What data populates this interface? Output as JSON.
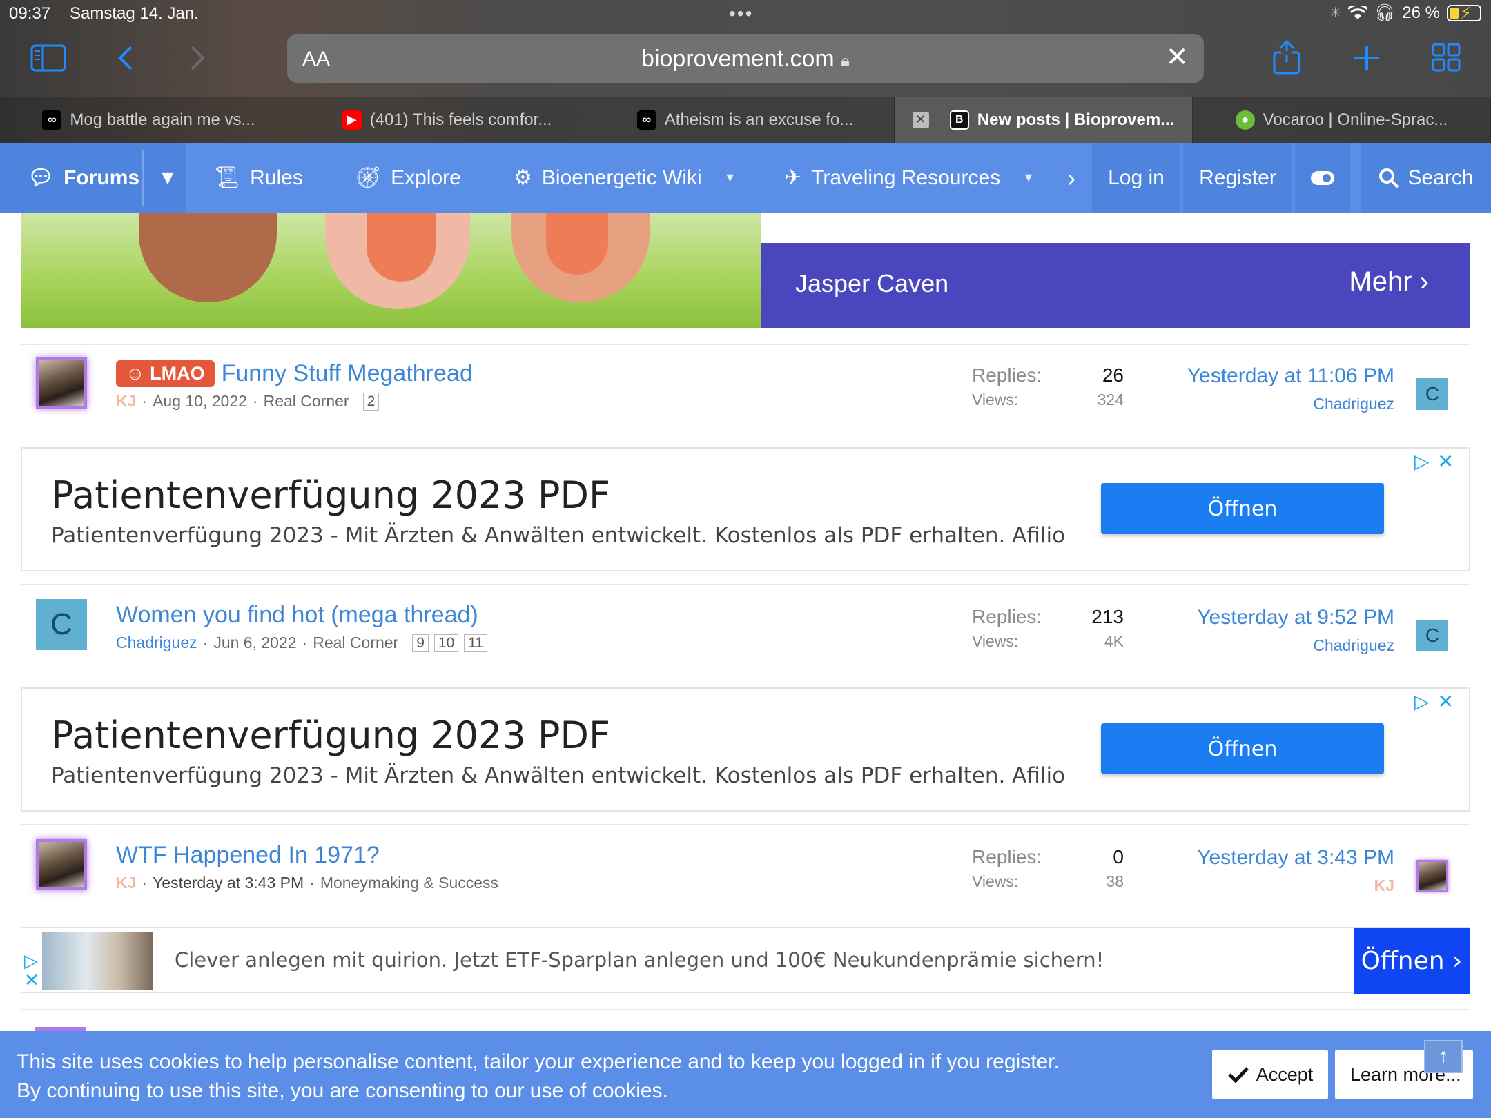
{
  "status": {
    "time": "09:37",
    "date": "Samstag 14. Jan.",
    "battery": "26 %"
  },
  "browser": {
    "address_aa": "AA",
    "url": "bioprovement.com",
    "tabs": [
      {
        "title": "Mog battle again me vs...",
        "favicon": "infinity-icon"
      },
      {
        "title": "(401) This feels comfor...",
        "favicon": "youtube-icon"
      },
      {
        "title": "Atheism is an excuse fo...",
        "favicon": "infinity-icon"
      },
      {
        "title": "New posts | Bioprovem...",
        "favicon": "b-icon",
        "active": true
      },
      {
        "title": "Vocaroo | Online-Sprac...",
        "favicon": "vocaroo-icon"
      }
    ]
  },
  "nav": {
    "forums": "Forums",
    "rules": "Rules",
    "explore": "Explore",
    "wiki": "Bioenergetic Wiki",
    "traveling": "Traveling Resources",
    "login": "Log in",
    "register": "Register",
    "search": "Search"
  },
  "top_ad": {
    "name": "Jasper Caven",
    "more": "Mehr"
  },
  "threads": [
    {
      "label": "LMAO",
      "title": "Funny Stuff Megathread",
      "author": "KJ",
      "date": "Aug 10, 2022",
      "forum": "Real Corner",
      "pages": [
        "2"
      ],
      "replies_label": "Replies:",
      "replies": "26",
      "views_label": "Views:",
      "views": "324",
      "last_time": "Yesterday at 11:06 PM",
      "last_user": "Chadriguez",
      "last_user_initial": "C"
    },
    {
      "title": "Women you find hot (mega thread)",
      "author": "Chadriguez",
      "author_initial": "C",
      "date": "Jun 6, 2022",
      "forum": "Real Corner",
      "pages": [
        "9",
        "10",
        "11"
      ],
      "replies_label": "Replies:",
      "replies": "213",
      "views_label": "Views:",
      "views": "4K",
      "last_time": "Yesterday at 9:52 PM",
      "last_user": "Chadriguez",
      "last_user_initial": "C"
    },
    {
      "title": "WTF Happened In 1971?",
      "author": "KJ",
      "date": "Yesterday at 3:43 PM",
      "forum": "Moneymaking & Success",
      "replies_label": "Replies:",
      "replies": "0",
      "views_label": "Views:",
      "views": "38",
      "last_time": "Yesterday at 3:43 PM",
      "last_user": "KJ"
    }
  ],
  "ads": [
    {
      "headline": "Patientenverfügung 2023 PDF",
      "body": "Patientenverfügung 2023 - Mit Ärzten & Anwälten entwickelt. Kostenlos als PDF erhalten. Afilio",
      "cta": "Öffnen"
    },
    {
      "headline": "Patientenverfügung 2023 PDF",
      "body": "Patientenverfügung 2023 - Mit Ärzten & Anwälten entwickelt. Kostenlos als PDF erhalten. Afilio",
      "cta": "Öffnen"
    }
  ],
  "banner_ad": {
    "text": "Clever anlegen mit quirion. Jetzt ETF-Sparplan anlegen und 100€ Neukundenprämie sichern!",
    "cta": "Öffnen"
  },
  "cookie": {
    "line1": "This site uses cookies to help personalise content, tailor your experience and to keep you logged in if you register.",
    "line2": "By continuing to use this site, you are consenting to our use of cookies.",
    "accept": "Accept",
    "learn_more": "Learn more..."
  },
  "colors": {
    "nav_blue": "#5b8ee6",
    "link_blue": "#3d86d6",
    "label_red": "#e5573a",
    "ad_button": "#1a7df2"
  }
}
